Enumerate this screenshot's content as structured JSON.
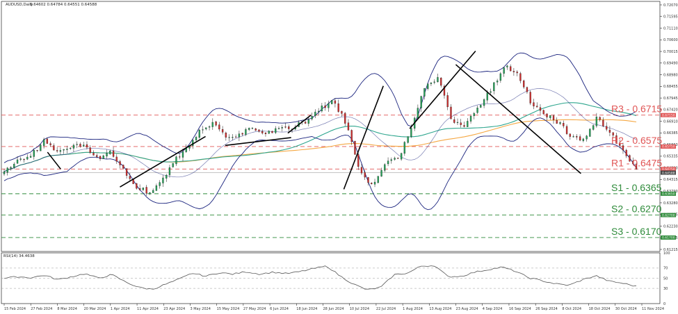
{
  "header": {
    "symbol": "AUDUSD,Daily",
    "ohlc": "0.64602 0.64784 0.64551 0.64588"
  },
  "rsi_header": "RSI(14) 34.4638",
  "chart_data": {
    "type": "candlestick",
    "ylim": [
      0.6108,
      0.7215
    ],
    "price_ticks": [
      "0.72070",
      "0.71595",
      "0.71110",
      "0.70600",
      "0.70015",
      "0.69490",
      "0.68980",
      "0.68455",
      "0.67945",
      "0.67420",
      "0.66910",
      "0.66385",
      "0.65860",
      "0.65335",
      "0.64810",
      "0.64315",
      "0.63790",
      "0.63280",
      "0.62755",
      "0.62230",
      "0.61725",
      "0.61215"
    ],
    "x_ticks": [
      "15 Feb 2024",
      "27 Feb 2024",
      "8 Mar 2024",
      "20 Mar 2024",
      "1 Apr 2024",
      "11 Apr 2024",
      "23 Apr 2024",
      "3 May 2024",
      "15 May 2024",
      "27 May 2024",
      "6 Jun 2024",
      "18 Jun 2024",
      "28 Jun 2024",
      "10 Jul 2024",
      "22 Jul 2024",
      "1 Aug 2024",
      "13 Aug 2024",
      "23 Aug 2024",
      "4 Sep 2024",
      "16 Sep 2024",
      "26 Sep 2024",
      "8 Oct 2024",
      "18 Oct 2024",
      "30 Oct 2024",
      "11 Nov 2024"
    ],
    "key_prices": [
      0.6458,
      0.651,
      0.653,
      0.66,
      0.6545,
      0.657,
      0.658,
      0.652,
      0.655,
      0.648,
      0.64,
      0.637,
      0.642,
      0.652,
      0.658,
      0.666,
      0.668,
      0.6615,
      0.6635,
      0.666,
      0.6635,
      0.6655,
      0.6665,
      0.669,
      0.674,
      0.6785,
      0.667,
      0.647,
      0.64,
      0.6495,
      0.653,
      0.6675,
      0.685,
      0.6875,
      0.6695,
      0.667,
      0.675,
      0.683,
      0.6935,
      0.69,
      0.677,
      0.672,
      0.6685,
      0.6625,
      0.6605,
      0.6705,
      0.6635,
      0.656,
      0.6475
    ],
    "levels": [
      {
        "label": "R3 - 0.6715",
        "value": 0.6715,
        "tag": "0.67150",
        "kind": "resistance"
      },
      {
        "label": "R2 - 0.6575",
        "value": 0.6575,
        "tag": "0.65750",
        "kind": "resistance"
      },
      {
        "label": "R1 - 0.6475",
        "value": 0.6475,
        "tag": "0.64750",
        "kind": "resistance"
      },
      {
        "label": "S1 - 0.6365",
        "value": 0.6365,
        "tag": "0.63650",
        "kind": "support"
      },
      {
        "label": "S2 - 0.6270",
        "value": 0.627,
        "tag": "0.62700",
        "kind": "support"
      },
      {
        "label": "S3 - 0.6170",
        "value": 0.617,
        "tag": "0.61700",
        "kind": "support"
      }
    ],
    "current_price": {
      "value": 0.64588,
      "tag": "0.64588"
    },
    "rsi": {
      "ylim": [
        0,
        100
      ],
      "ticks": [
        "100",
        "70",
        "50",
        "30",
        "0"
      ],
      "levels": [
        70,
        50,
        30
      ],
      "values": [
        50,
        53,
        51,
        56,
        47,
        53,
        59,
        50,
        57,
        43,
        32,
        28,
        38,
        48,
        60,
        54,
        61,
        58,
        63,
        58,
        62,
        59,
        63,
        69,
        74,
        54,
        38,
        27,
        32,
        57,
        60,
        74,
        75,
        53,
        54,
        62,
        67,
        72,
        64,
        51,
        45,
        39,
        36,
        47,
        55,
        44,
        40,
        34
      ]
    },
    "colors": {
      "up": "#26a65b",
      "down": "#d32f2f",
      "bollinger": "#1a237e",
      "ma_fast": "#2ca58d",
      "ma_slow": "#f5a742",
      "resistance": "#e05555",
      "support": "#2e8b3a",
      "trend": "#000000",
      "rsi": "#555555"
    }
  }
}
